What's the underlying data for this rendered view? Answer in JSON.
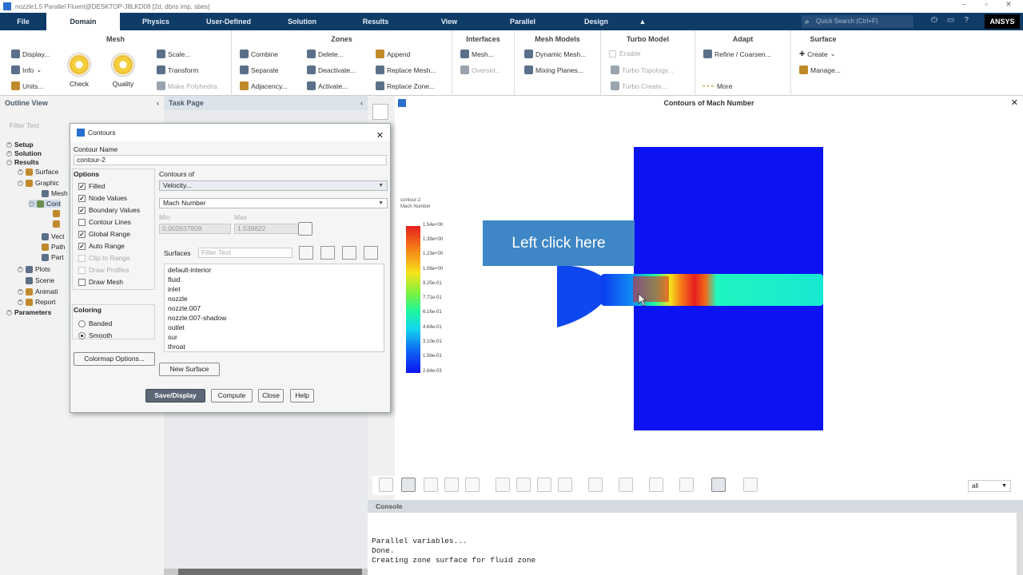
{
  "window": {
    "title": "nozzle1.5 Parallel Fluent@DESKTOP-J8LKD08  [2d, dbns imp, sbes]"
  },
  "menubar": {
    "items": [
      "File",
      "Domain",
      "Physics",
      "User-Defined",
      "Solution",
      "Results",
      "View",
      "Parallel",
      "Design"
    ],
    "active": "Domain",
    "search_placeholder": "Quick Search (Ctrl+F)",
    "brand": "ANSYS"
  },
  "ribbon": {
    "mesh": {
      "title": "Mesh",
      "display": "Display...",
      "info": "Info",
      "units": "Units...",
      "check": "Check",
      "quality": "Quality",
      "scale": "Scale...",
      "transform": "Transform",
      "make_polyhedra": "Make Polyhedra"
    },
    "zones": {
      "title": "Zones",
      "combine": "Combine",
      "separate": "Separate",
      "adjacency": "Adjacency...",
      "delete": "Delete...",
      "deactivate": "Deactivate...",
      "activate": "Activate...",
      "append": "Append",
      "replace_mesh": "Replace Mesh...",
      "replace_zone": "Replace Zone..."
    },
    "interfaces": {
      "title": "Interfaces",
      "mesh": "Mesh...",
      "overset": "Overset..."
    },
    "mesh_models": {
      "title": "Mesh Models",
      "dynamic_mesh": "Dynamic Mesh...",
      "mixing_planes": "Mixing Planes..."
    },
    "turbo_model": {
      "title": "Turbo Model",
      "enable": "Enable",
      "turbo_topology": "Turbo Topology...",
      "turbo_create": "Turbo Create..."
    },
    "adapt": {
      "title": "Adapt",
      "refine_coarsen": "Refine / Coarsen...",
      "more": "More"
    },
    "surface": {
      "title": "Surface",
      "create": "Create",
      "manage": "Manage..."
    }
  },
  "outline": {
    "title": "Outline View",
    "filter_placeholder": "Filter Text",
    "items": {
      "setup": "Setup",
      "solution": "Solution",
      "results": "Results",
      "surfaces": "Surface",
      "graphics": "Graphic",
      "mesh": "Mesh",
      "contours": "Cont",
      "vectors": "Vect",
      "pathlines": "Path",
      "particles": "Part",
      "plots": "Plots",
      "scene": "Scene",
      "animations": "Animati",
      "reports": "Report",
      "parameters": "Parameters"
    }
  },
  "task_page": {
    "title": "Task Page"
  },
  "dialog": {
    "title": "Contours",
    "contour_name_label": "Contour Name",
    "contour_name": "contour-2",
    "options_label": "Options",
    "options": {
      "filled": "Filled",
      "node_values": "Node Values",
      "boundary_values": "Boundary Values",
      "contour_lines": "Contour Lines",
      "global_range": "Global Range",
      "auto_range": "Auto Range",
      "clip_to_range": "Clip to Range",
      "draw_profiles": "Draw Profiles",
      "draw_mesh": "Draw Mesh"
    },
    "contours_of_label": "Contours of",
    "contours_of": "Velocity...",
    "contours_sub": "Mach Number",
    "min_label": "Min",
    "max_label": "Max",
    "min": "0.002637809",
    "max": "1.539822",
    "surfaces_label": "Surfaces",
    "surfaces_filter": "Filter Text",
    "surfaces": [
      "default-interior",
      "fluid",
      "inlet",
      "nozzle",
      "nozzle:007",
      "nozzle:007-shadow",
      "outlet",
      "sur",
      "throat"
    ],
    "coloring_label": "Coloring",
    "banded": "Banded",
    "smooth": "Smooth",
    "colormap_options": "Colormap Options...",
    "new_surface": "New Surface",
    "save_display": "Save/Display",
    "compute": "Compute",
    "close": "Close",
    "help": "Help"
  },
  "graphics": {
    "title": "Contours of Mach Number",
    "legend_title": "contour-2",
    "legend_subtitle": "Mach Number",
    "legend_values": [
      "1.54e+00",
      "1.39e+00",
      "1.23e+00",
      "1.08e+00",
      "9.25e-01",
      "7.71e-01",
      "6.16e-01",
      "4.64e-01",
      "3.10e-01",
      "1.56e-01",
      "2.64e-03"
    ],
    "callout": "Left click here",
    "view_select": "all"
  },
  "console": {
    "title": "Console",
    "lines": [
      "Parallel variables...",
      "Done.",
      "Creating zone surface for fluid zone"
    ]
  },
  "colors": {
    "menubar": "#0f3b67",
    "domain_blue": "#0b13f2",
    "callout": "#3e86c5",
    "primary_btn": "#5d6877"
  }
}
